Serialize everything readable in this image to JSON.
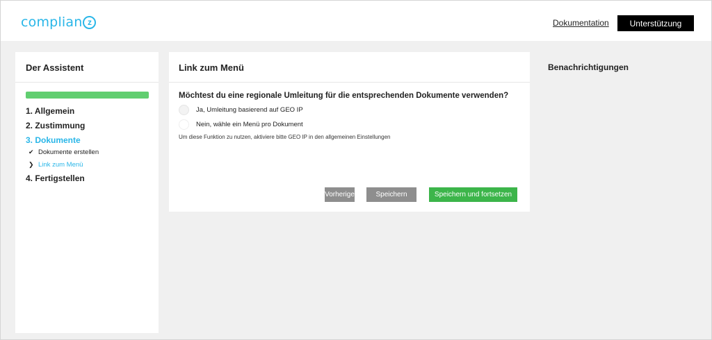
{
  "header": {
    "logo_text": "complian",
    "logo_mark": "z",
    "documentation_label": "Dokumentation",
    "support_label": "Unterstützung"
  },
  "colors": {
    "brand": "#29b6e8",
    "progress": "#61ce70",
    "primary_button": "#3cb54a",
    "secondary_button": "#8e8e8e"
  },
  "sidebar": {
    "title": "Der Assistent",
    "progress": 1.0,
    "steps": [
      {
        "label": "1. Allgemein"
      },
      {
        "label": "2. Zustimmung"
      },
      {
        "label": "3. Dokumente",
        "active": true
      },
      {
        "label": "4. Fertigstellen"
      }
    ],
    "substeps": [
      {
        "label": "Dokumente erstellen",
        "icon": "check-icon"
      },
      {
        "label": "Link zum Menü",
        "icon": "chevron-right-icon",
        "active": true
      }
    ]
  },
  "main": {
    "title": "Link zum Menü",
    "question": "Möchtest du eine regionale Umleitung für die entsprechenden Dokumente verwenden?",
    "options": [
      {
        "label": "Ja, Umleitung basierend auf GEO IP"
      },
      {
        "label": "Nein, wähle ein Menü pro Dokument"
      }
    ],
    "hint": "Um diese Funktion zu nutzen, aktiviere bitte GEO IP in den allgemeinen Einstellungen",
    "buttons": {
      "previous": "Vorherige",
      "save": "Speichern",
      "save_continue": "Speichern und fortsetzen"
    }
  },
  "notifications": {
    "title": "Benachrichtigungen"
  }
}
